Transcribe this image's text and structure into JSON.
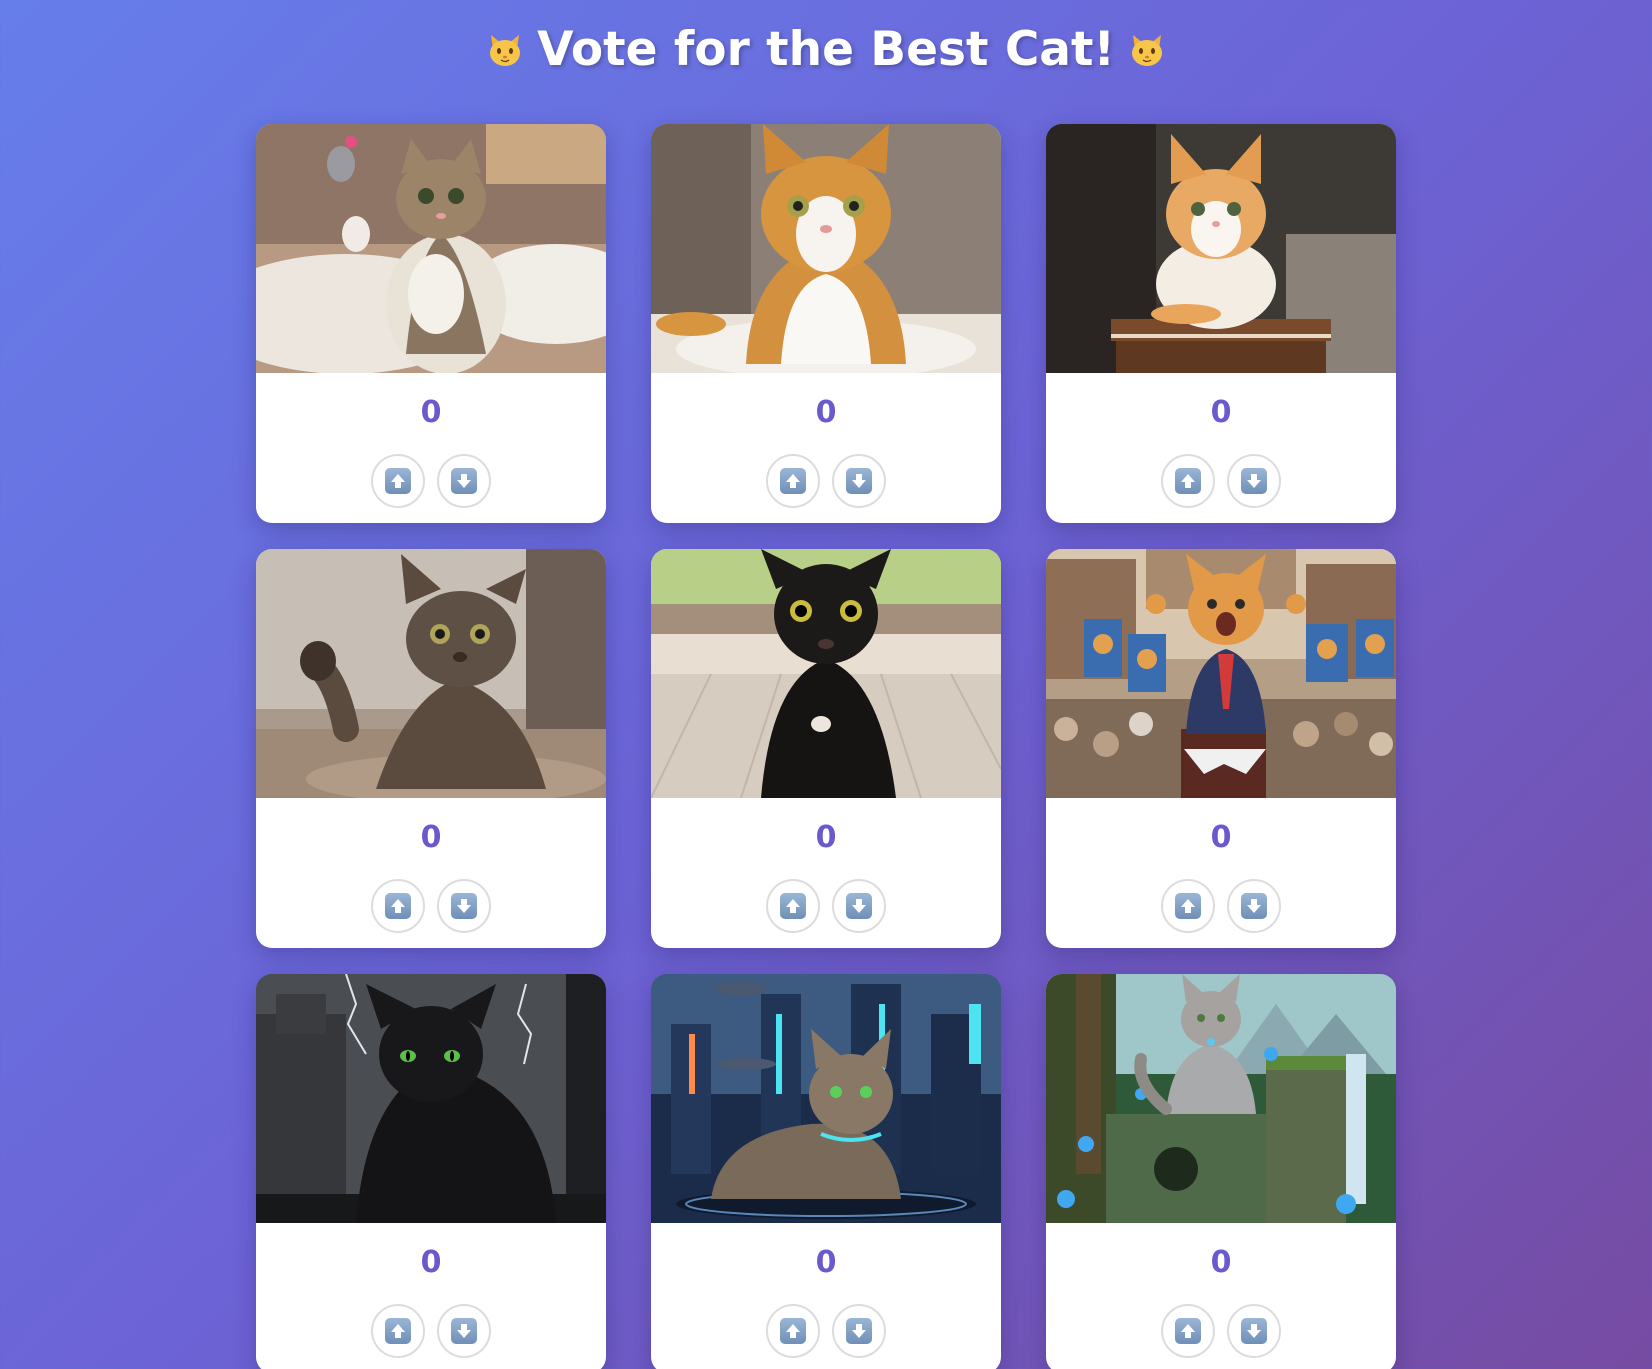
{
  "page": {
    "title": "Vote for the Best Cat!",
    "title_icon": "cat-face-emoji",
    "background_gradient": [
      "#667eea",
      "#764ba2"
    ]
  },
  "accent_color": "#6a5acd",
  "cats": [
    {
      "score": "0",
      "scene": "tabby-kitten-playing-with-toy-mouse",
      "upvote_icon": "up-arrow-icon",
      "downvote_icon": "down-arrow-icon"
    },
    {
      "score": "0",
      "scene": "orange-white-cat-sitting-on-rug",
      "upvote_icon": "up-arrow-icon",
      "downvote_icon": "down-arrow-icon"
    },
    {
      "score": "0",
      "scene": "orange-white-kitten-on-books",
      "upvote_icon": "up-arrow-icon",
      "downvote_icon": "down-arrow-icon"
    },
    {
      "score": "0",
      "scene": "tabby-cat-raising-paw",
      "upvote_icon": "up-arrow-icon",
      "downvote_icon": "down-arrow-icon"
    },
    {
      "score": "0",
      "scene": "black-cat-surprised-on-wood-floor",
      "upvote_icon": "up-arrow-icon",
      "downvote_icon": "down-arrow-icon"
    },
    {
      "score": "0",
      "scene": "orange-cat-politician-rally",
      "upvote_icon": "up-arrow-icon",
      "downvote_icon": "down-arrow-icon"
    },
    {
      "score": "0",
      "scene": "black-cat-stormy-window",
      "upvote_icon": "up-arrow-icon",
      "downvote_icon": "down-arrow-icon"
    },
    {
      "score": "0",
      "scene": "tabby-cat-futuristic-city",
      "upvote_icon": "up-arrow-icon",
      "downvote_icon": "down-arrow-icon"
    },
    {
      "score": "0",
      "scene": "gray-cat-fantasy-forest-ruins",
      "upvote_icon": "up-arrow-icon",
      "downvote_icon": "down-arrow-icon"
    }
  ]
}
